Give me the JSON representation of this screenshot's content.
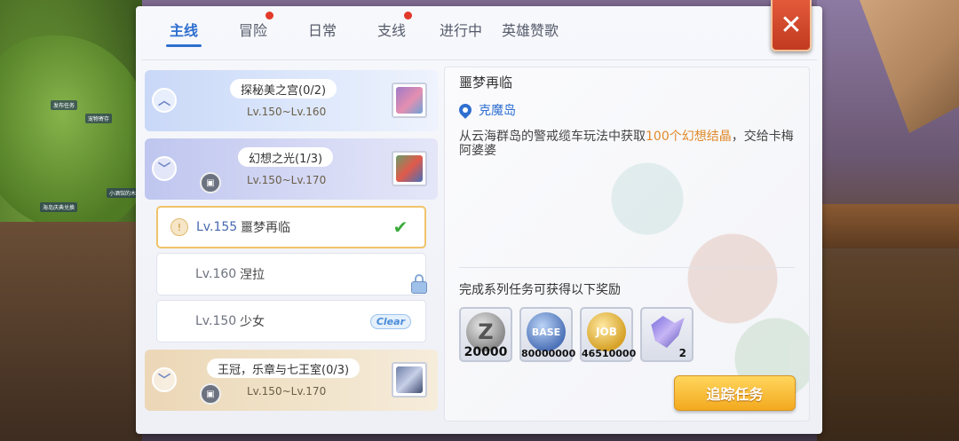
{
  "scene": {
    "tags": [
      "小酒馆的木",
      "发布任务",
      "海岛庆典兑换",
      "宠物寄存"
    ]
  },
  "tabs": [
    {
      "label": "主线",
      "active": true,
      "dot": false
    },
    {
      "label": "冒险",
      "active": false,
      "dot": true
    },
    {
      "label": "日常",
      "active": false,
      "dot": false
    },
    {
      "label": "支线",
      "active": false,
      "dot": true
    },
    {
      "label": "进行中",
      "active": false,
      "dot": false
    },
    {
      "label": "英雄赞歌",
      "active": false,
      "dot": false
    }
  ],
  "close_label": "✕",
  "chapters": [
    {
      "title": "探秘美之宫(0/2)",
      "range": "Lv.150~Lv.160",
      "expanded": false
    },
    {
      "title": "幻想之光(1/3)",
      "range": "Lv.150~Lv.170",
      "expanded": true
    },
    {
      "title": "王冠，乐章与七王室(0/3)",
      "range": "Lv.150~Lv.170",
      "expanded": true
    }
  ],
  "quests": [
    {
      "level": "Lv.155",
      "name": "噩梦再临",
      "status": "check",
      "selected": true
    },
    {
      "level": "Lv.160",
      "name": "涅拉",
      "status": "lock",
      "selected": false
    },
    {
      "level": "Lv.150",
      "name": "少女",
      "status": "clear",
      "status_label": "Clear",
      "selected": false
    }
  ],
  "detail": {
    "title": "噩梦再临",
    "location": "克魔岛",
    "desc_before": "从云海群岛的警戒缆车玩法中获取",
    "desc_highlight": "100个幻想结晶",
    "desc_after": "，交给卡梅阿婆婆",
    "reward_title": "完成系列任务可获得以下奖励",
    "rewards": [
      {
        "icon": "zeny-coin-icon",
        "glyph": "Z",
        "amount": "20000"
      },
      {
        "icon": "base-exp-icon",
        "glyph": "BASE",
        "amount": "80000000"
      },
      {
        "icon": "job-exp-icon",
        "glyph": "JOB",
        "amount": "46510000"
      },
      {
        "icon": "fantasy-crystal-icon",
        "glyph": "",
        "amount": "2"
      }
    ],
    "track_button": "追踪任务"
  }
}
